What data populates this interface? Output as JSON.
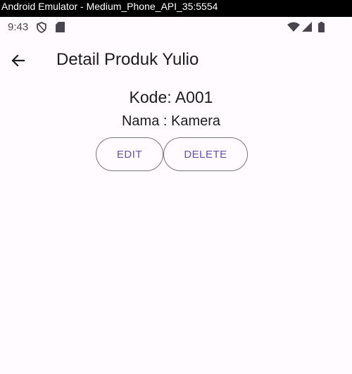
{
  "window": {
    "title": "Android Emulator - Medium_Phone_API_35:5554"
  },
  "statusbar": {
    "time": "9:43"
  },
  "appbar": {
    "title": "Detail Produk Yulio"
  },
  "product": {
    "kode": "Kode: A001",
    "nama": "Nama : Kamera"
  },
  "actions": {
    "edit_label": "EDIT",
    "delete_label": "DELETE"
  },
  "icons": {
    "statusbar_left": [
      "shield-icon",
      "sd-card-icon"
    ],
    "statusbar_right": [
      "wifi-icon",
      "cell-signal-icon",
      "battery-icon"
    ],
    "appbar": [
      "arrow-back-icon"
    ]
  },
  "colors": {
    "background": "#fffbfe",
    "primary": "#6750a4",
    "outline": "#79747e",
    "on_surface": "#1c1b1f"
  }
}
